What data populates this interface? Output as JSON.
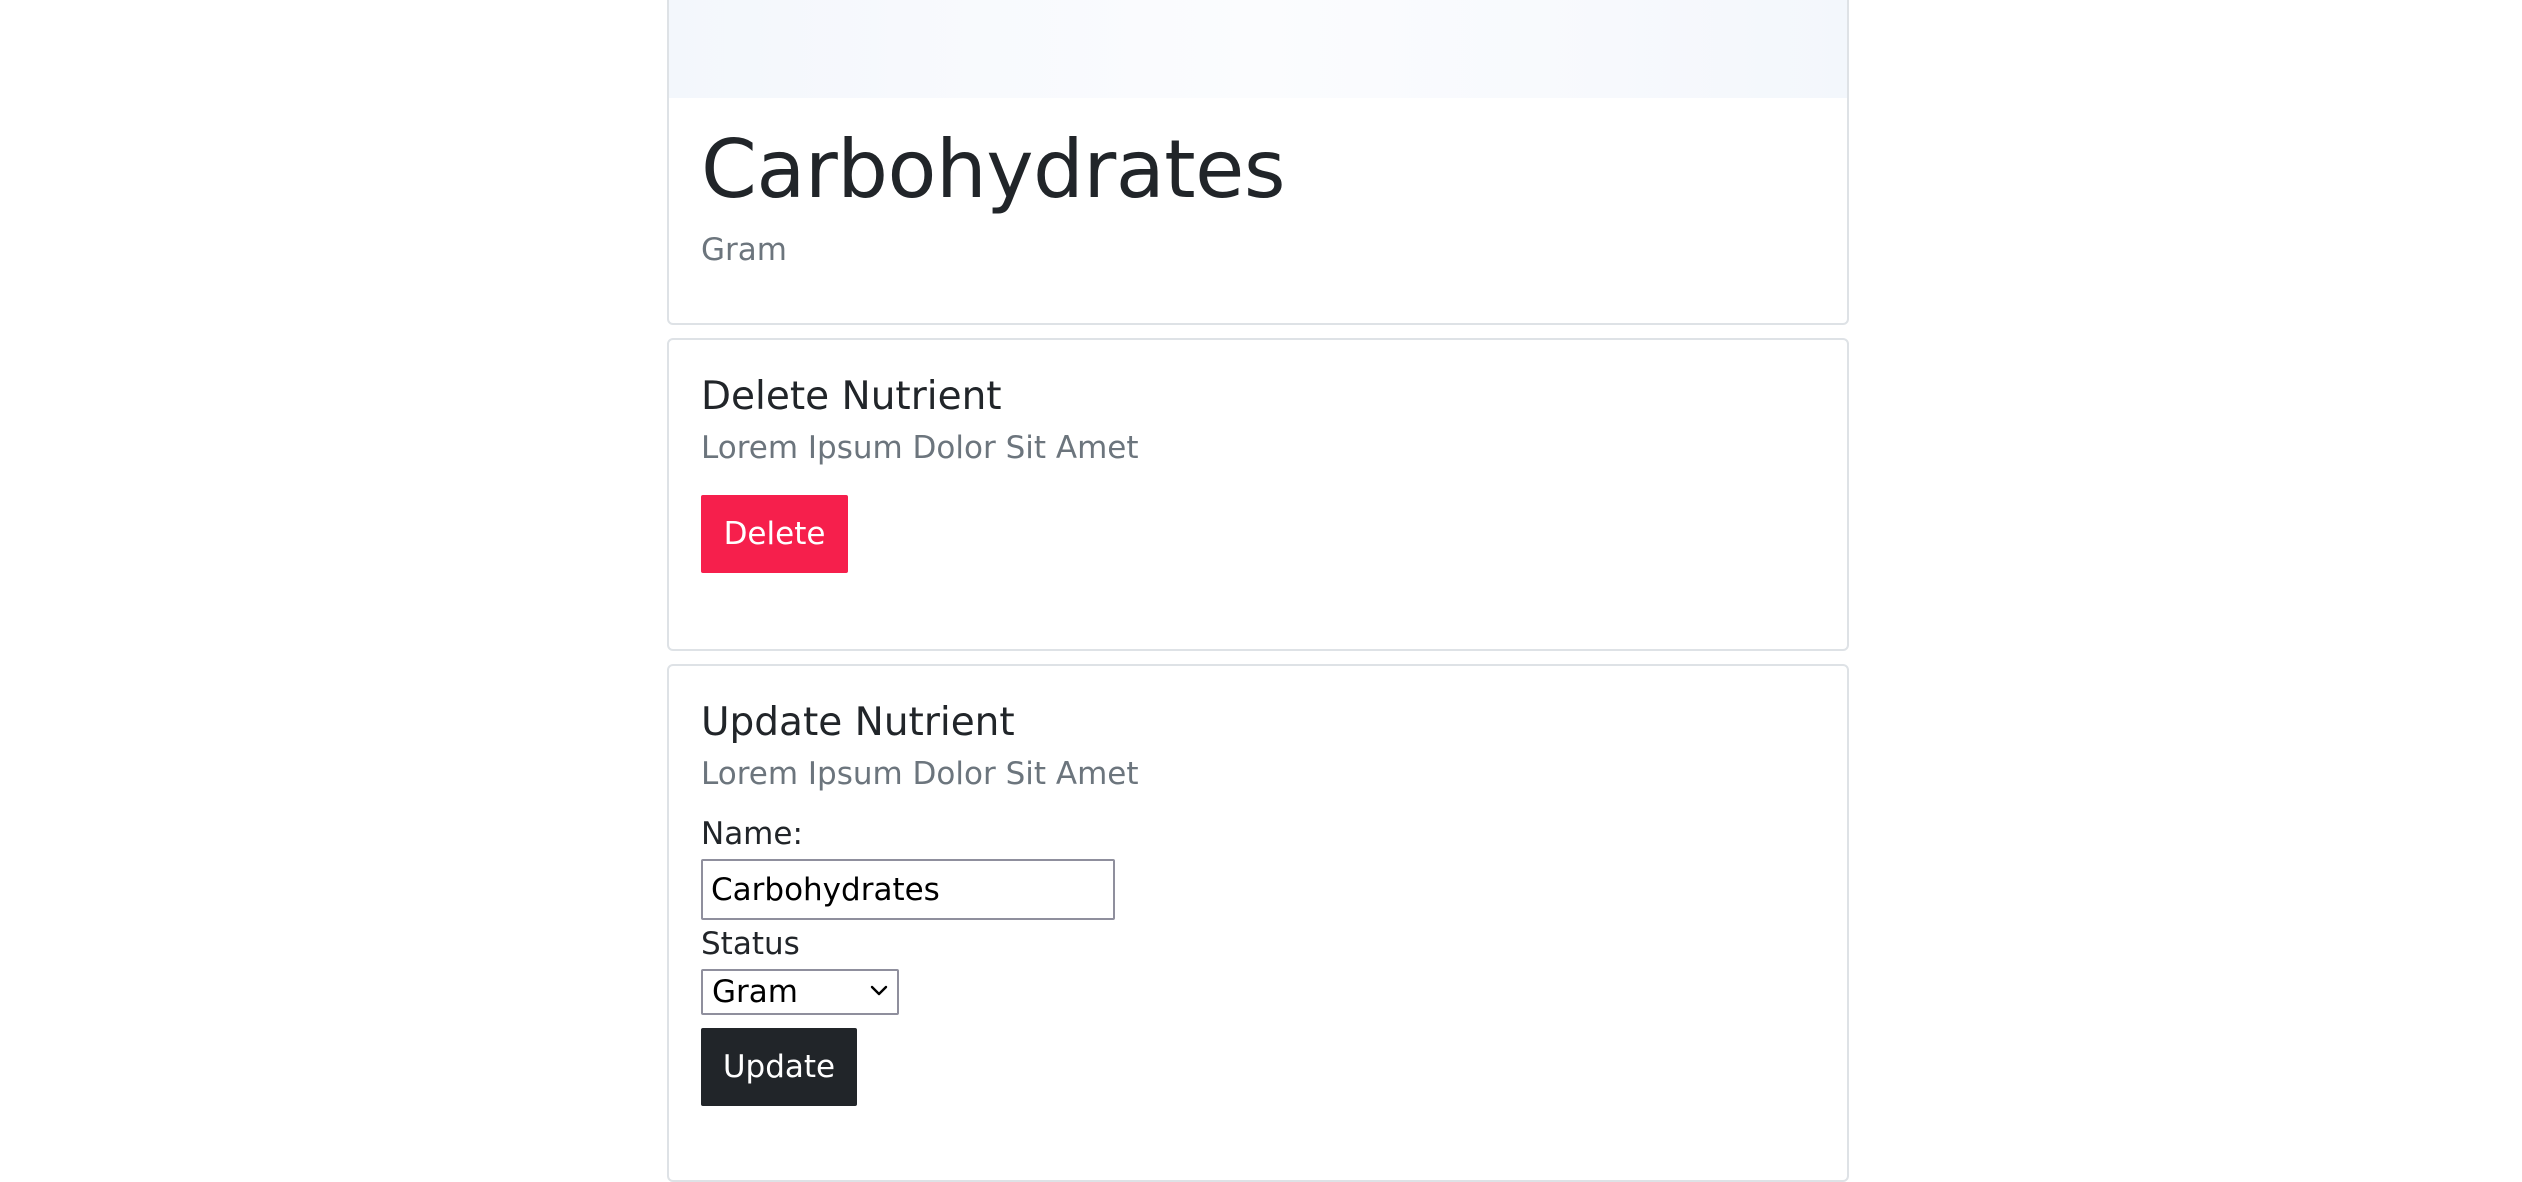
{
  "nutrient": {
    "title": "Carbohydrates",
    "unit": "Gram"
  },
  "delete_section": {
    "title": "Delete Nutrient",
    "subtitle": "Lorem Ipsum Dolor Sit Amet",
    "button_label": "Delete"
  },
  "update_section": {
    "title": "Update Nutrient",
    "subtitle": "Lorem Ipsum Dolor Sit Amet",
    "name_label": "Name:",
    "name_value": "Carbohydrates",
    "status_label": "Status",
    "status_selected": "Gram",
    "button_label": "Update"
  },
  "colors": {
    "danger": "#f61f4c",
    "dark": "#212529",
    "muted": "#6c757d",
    "border": "#dee2e6"
  },
  "icons": {
    "select_arrow": "chevron-down-icon"
  }
}
